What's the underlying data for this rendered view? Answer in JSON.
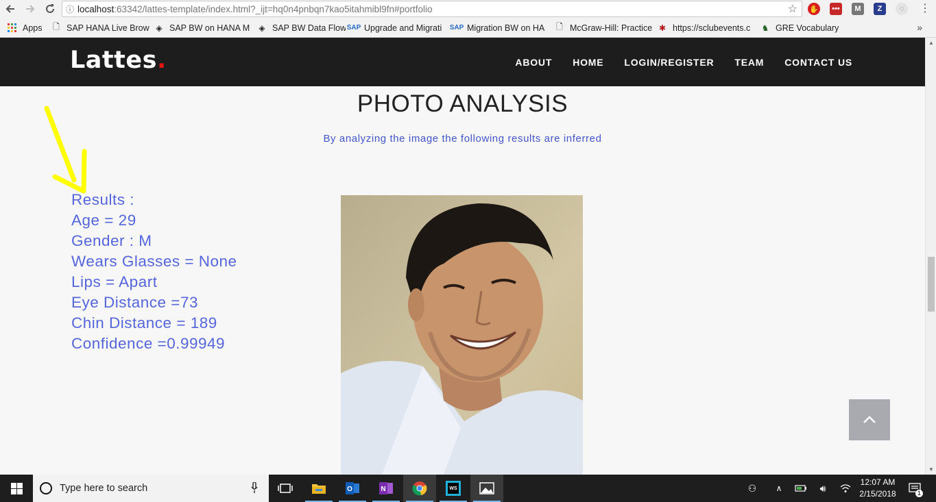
{
  "browser": {
    "url_host": "localhost",
    "url_rest": ":63342/lattes-template/index.html?_ijt=hq0n4pnbqn7kao5itahmibl9fn#portfolio",
    "bookmarks": [
      {
        "label": "Apps",
        "icon": "apps-grid-icon"
      },
      {
        "label": "SAP HANA Live Brow",
        "icon": "page-icon"
      },
      {
        "label": "SAP BW on HANA M",
        "icon": "diamond-icon"
      },
      {
        "label": "SAP BW Data Flow",
        "icon": "diamond-icon"
      },
      {
        "label": "Upgrade and Migrati",
        "icon": "sap-icon"
      },
      {
        "label": "Migration BW on HA",
        "icon": "sap-icon"
      },
      {
        "label": "McGraw-Hill: Practice",
        "icon": "page-icon"
      },
      {
        "label": "https://sclubevents.c",
        "icon": "bug-icon"
      },
      {
        "label": "GRE Vocabulary",
        "icon": "spartan-icon"
      }
    ],
    "more_label": "»"
  },
  "site": {
    "logo": "Lattes",
    "logo_dot": ".",
    "menu": [
      "ABOUT",
      "HOME",
      "LOGIN/REGISTER",
      "TEAM",
      "CONTACT US"
    ]
  },
  "section": {
    "title": "PHOTO ANALYSIS",
    "subtitle": "By analyzing the image the following results are inferred"
  },
  "results": [
    "Results :",
    "Age = 29",
    "Gender : M",
    "Wears Glasses = None",
    "Lips = Apart",
    "Eye Distance =73",
    "Chin Distance = 189",
    "Confidence =0.99949"
  ],
  "taskbar": {
    "search_placeholder": "Type here to search",
    "time": "12:07 AM",
    "date": "2/15/2018",
    "notification_count": "1"
  },
  "colors": {
    "accent_text": "#5566dd",
    "nav_bg": "#1d1d1d",
    "logo_dot": "#e01515",
    "annotation_arrow": "#ffff00"
  }
}
